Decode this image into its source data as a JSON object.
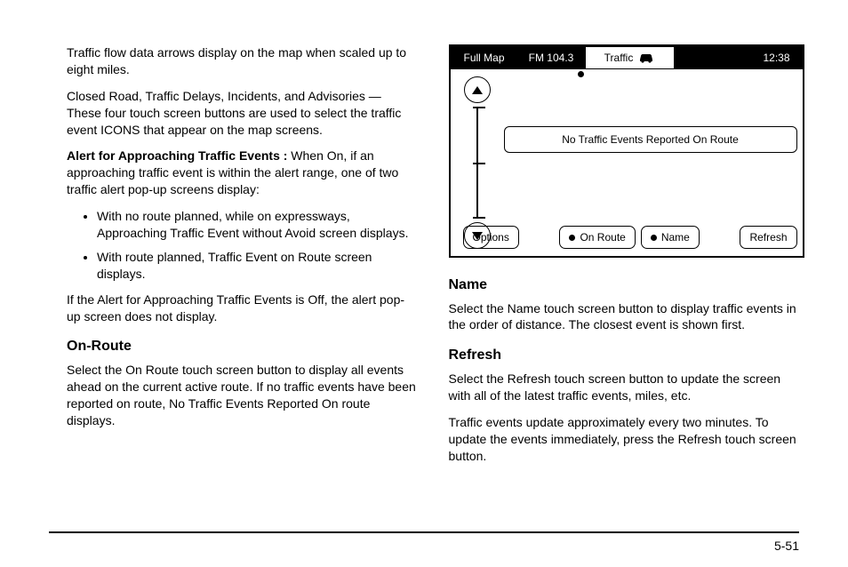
{
  "left": {
    "p1": "Traffic flow data arrows display on the map when scaled up to eight miles.",
    "p2": "Closed Road, Traffic Delays, Incidents, and Advisories — These four touch screen buttons are used to select the traffic event ICONS that appear on the map screens.",
    "p3_bold": "Alert for Approaching Traffic Events :",
    "p3_rest": " When On, if an approaching traffic event is within the alert range, one of two traffic alert pop-up screens display:",
    "li1": "With no route planned, while on expressways, Approaching Traffic Event without Avoid screen displays.",
    "li2": "With route planned, Traffic Event on Route screen displays.",
    "p4": "If the Alert for Approaching Traffic Events is Off, the alert pop-up screen does not display.",
    "h_onroute": "On-Route",
    "p_onroute": "Select the On Route touch screen button to display all events ahead on the current active route. If no traffic events have been reported on route, No Traffic Events Reported On route displays."
  },
  "right": {
    "h_name": "Name",
    "p_name": "Select the Name touch screen button to display traffic events in the order of distance. The closest event is shown first.",
    "h_refresh": "Refresh",
    "p_refresh1": "Select the Refresh touch screen button to update the screen with all of the latest traffic events, miles, etc.",
    "p_refresh2": "Traffic events update approximately every two minutes. To update the events immediately, press the Refresh touch screen button."
  },
  "device": {
    "full_map": "Full Map",
    "fm": "FM 104.3",
    "traffic": "Traffic",
    "clock": "12:38",
    "banner": "No Traffic Events Reported On Route",
    "options": "Options",
    "on_route": "On Route",
    "name": "Name",
    "refresh": "Refresh"
  },
  "page_number": "5-51"
}
